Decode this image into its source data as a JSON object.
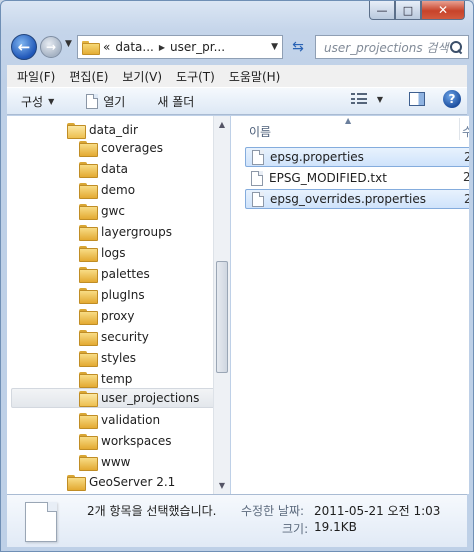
{
  "window": {
    "buttons": {
      "minimize": "—",
      "maximize": "□",
      "close": "✕"
    }
  },
  "address": {
    "crumbs": [
      "«",
      "data...",
      "user_pr..."
    ],
    "search_placeholder": "user_projections 검색"
  },
  "menu": [
    "파일(F)",
    "편집(E)",
    "보기(V)",
    "도구(T)",
    "도움말(H)"
  ],
  "toolbar": {
    "organize": "구성",
    "open": "열기",
    "new_folder": "새 폴더"
  },
  "tree": [
    {
      "label": "data_dir",
      "level": 0
    },
    {
      "label": "coverages",
      "level": 1
    },
    {
      "label": "data",
      "level": 1
    },
    {
      "label": "demo",
      "level": 1
    },
    {
      "label": "gwc",
      "level": 1
    },
    {
      "label": "layergroups",
      "level": 1
    },
    {
      "label": "logs",
      "level": 1
    },
    {
      "label": "palettes",
      "level": 1
    },
    {
      "label": "plugIns",
      "level": 1
    },
    {
      "label": "proxy",
      "level": 1
    },
    {
      "label": "security",
      "level": 1
    },
    {
      "label": "styles",
      "level": 1
    },
    {
      "label": "temp",
      "level": 1
    },
    {
      "label": "user_projections",
      "level": 1,
      "selected": true
    },
    {
      "label": "validation",
      "level": 1
    },
    {
      "label": "workspaces",
      "level": 1
    },
    {
      "label": "www",
      "level": 1
    },
    {
      "label": "GeoServer 2.1",
      "level": 0
    }
  ],
  "file_list": {
    "column_name": "이름",
    "column_next": "수",
    "files": [
      {
        "name": "epsg.properties",
        "trail": "2",
        "selected": true
      },
      {
        "name": "EPSG_MODIFIED.txt",
        "trail": "2",
        "selected": false
      },
      {
        "name": "epsg_overrides.properties",
        "trail": "2",
        "selected": true
      }
    ]
  },
  "details": {
    "selection_count": "2개 항목을 선택했습니다.",
    "modified_label": "수정한 날짜:",
    "modified_value": "2011-05-21 오전 1:03",
    "size_label": "크기:",
    "size_value": "19.1KB"
  }
}
